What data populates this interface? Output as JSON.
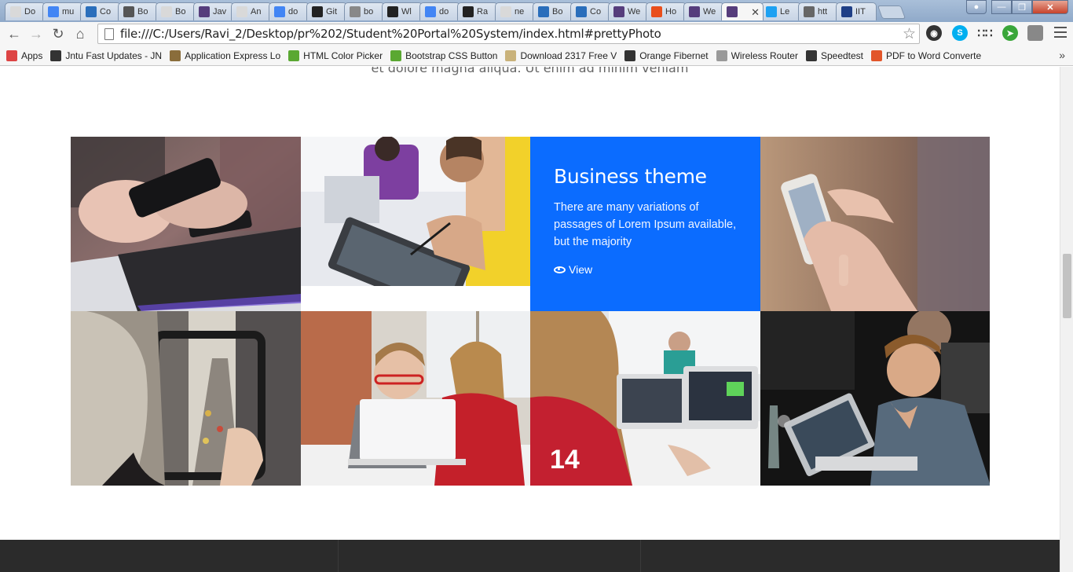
{
  "browser": {
    "tabs": [
      {
        "label": "Do",
        "icon": "doc-icon",
        "color": "#d9d9d9"
      },
      {
        "label": "mu",
        "icon": "google-icon",
        "color": "#4285f4"
      },
      {
        "label": "Co",
        "icon": "code-icon",
        "color": "#2a6ebb"
      },
      {
        "label": "Bo",
        "icon": "bootstrap-icon",
        "color": "#555555"
      },
      {
        "label": "Bo",
        "icon": "doc-icon",
        "color": "#d9d9d9"
      },
      {
        "label": "Jav",
        "icon": "bootstrap-icon",
        "color": "#563d7c"
      },
      {
        "label": "An",
        "icon": "doc-icon",
        "color": "#d9d9d9"
      },
      {
        "label": "do",
        "icon": "google-icon",
        "color": "#4285f4"
      },
      {
        "label": "Git",
        "icon": "github-icon",
        "color": "#222222"
      },
      {
        "label": "bo",
        "icon": "c-icon",
        "color": "#888888"
      },
      {
        "label": "Wl",
        "icon": "github-icon",
        "color": "#222222"
      },
      {
        "label": "do",
        "icon": "google-icon",
        "color": "#4285f4"
      },
      {
        "label": "Ra",
        "icon": "github-icon",
        "color": "#222222"
      },
      {
        "label": "ne",
        "icon": "doc-icon",
        "color": "#d9d9d9"
      },
      {
        "label": "Bo",
        "icon": "code-icon",
        "color": "#2a6ebb"
      },
      {
        "label": "Co",
        "icon": "code-icon",
        "color": "#2a6ebb"
      },
      {
        "label": "We",
        "icon": "bootstrap-icon",
        "color": "#563d7c"
      },
      {
        "label": "Ho",
        "icon": "joomla-icon",
        "color": "#e94e1b"
      },
      {
        "label": "We",
        "icon": "bootstrap-icon",
        "color": "#563d7c"
      },
      {
        "label": "",
        "icon": "bootstrap-icon",
        "color": "#563d7c",
        "active": true
      },
      {
        "label": "Le",
        "icon": "twitter-icon",
        "color": "#1da1f2"
      },
      {
        "label": "htt",
        "icon": "wifi-icon",
        "color": "#666666"
      },
      {
        "label": "IIT",
        "icon": "iit-icon",
        "color": "#1f3f86"
      }
    ]
  },
  "toolbar": {
    "url": "file:///C:/Users/Ravi_2/Desktop/pr%202/Student%20Portal%20System/index.html#prettyPhoto"
  },
  "bookmarks": [
    {
      "label": "Apps",
      "icon": "apps-grid-icon",
      "color": "#d44"
    },
    {
      "label": "Jntu Fast Updates - JN",
      "icon": "graduation-cap-icon",
      "color": "#333"
    },
    {
      "label": "Application Express Lo",
      "icon": "image-icon",
      "color": "#8a6d3b"
    },
    {
      "label": "HTML Color Picker",
      "icon": "color-picker-icon",
      "color": "#5aa832"
    },
    {
      "label": "Bootstrap CSS Button",
      "icon": "color-picker-icon",
      "color": "#5aa832"
    },
    {
      "label": "Download 2317 Free V",
      "icon": "folder-icon",
      "color": "#c9b27a"
    },
    {
      "label": "Orange Fibernet",
      "icon": "wifi-icon",
      "color": "#333"
    },
    {
      "label": "Wireless Router",
      "icon": "page-icon",
      "color": "#999"
    },
    {
      "label": "Speedtest",
      "icon": "gauge-icon",
      "color": "#333"
    },
    {
      "label": "PDF to Word Converte",
      "icon": "pdf-icon",
      "color": "#e2562a"
    }
  ],
  "page": {
    "intro_text": "et dolore magna aliqua. Ut enim ad minim veniam",
    "gallery": [
      {
        "name": "portfolio-item-phone-tablet",
        "kind": "photo"
      },
      {
        "name": "portfolio-item-drawing-tablet",
        "kind": "photo"
      },
      {
        "name": "portfolio-item-business-theme",
        "kind": "overlay",
        "title": "Business theme",
        "description": "There are many variations of passages of Lorem Ipsum available, but the majority",
        "link_label": "View"
      },
      {
        "name": "portfolio-item-hand-phone",
        "kind": "photo"
      },
      {
        "name": "portfolio-item-city-phone",
        "kind": "photo"
      },
      {
        "name": "portfolio-item-kids-laptop",
        "kind": "photo"
      },
      {
        "name": "portfolio-item-boy-laptop",
        "kind": "photo"
      },
      {
        "name": "portfolio-item-man-laptop",
        "kind": "photo"
      }
    ],
    "accent_color": "#0b6cff"
  }
}
